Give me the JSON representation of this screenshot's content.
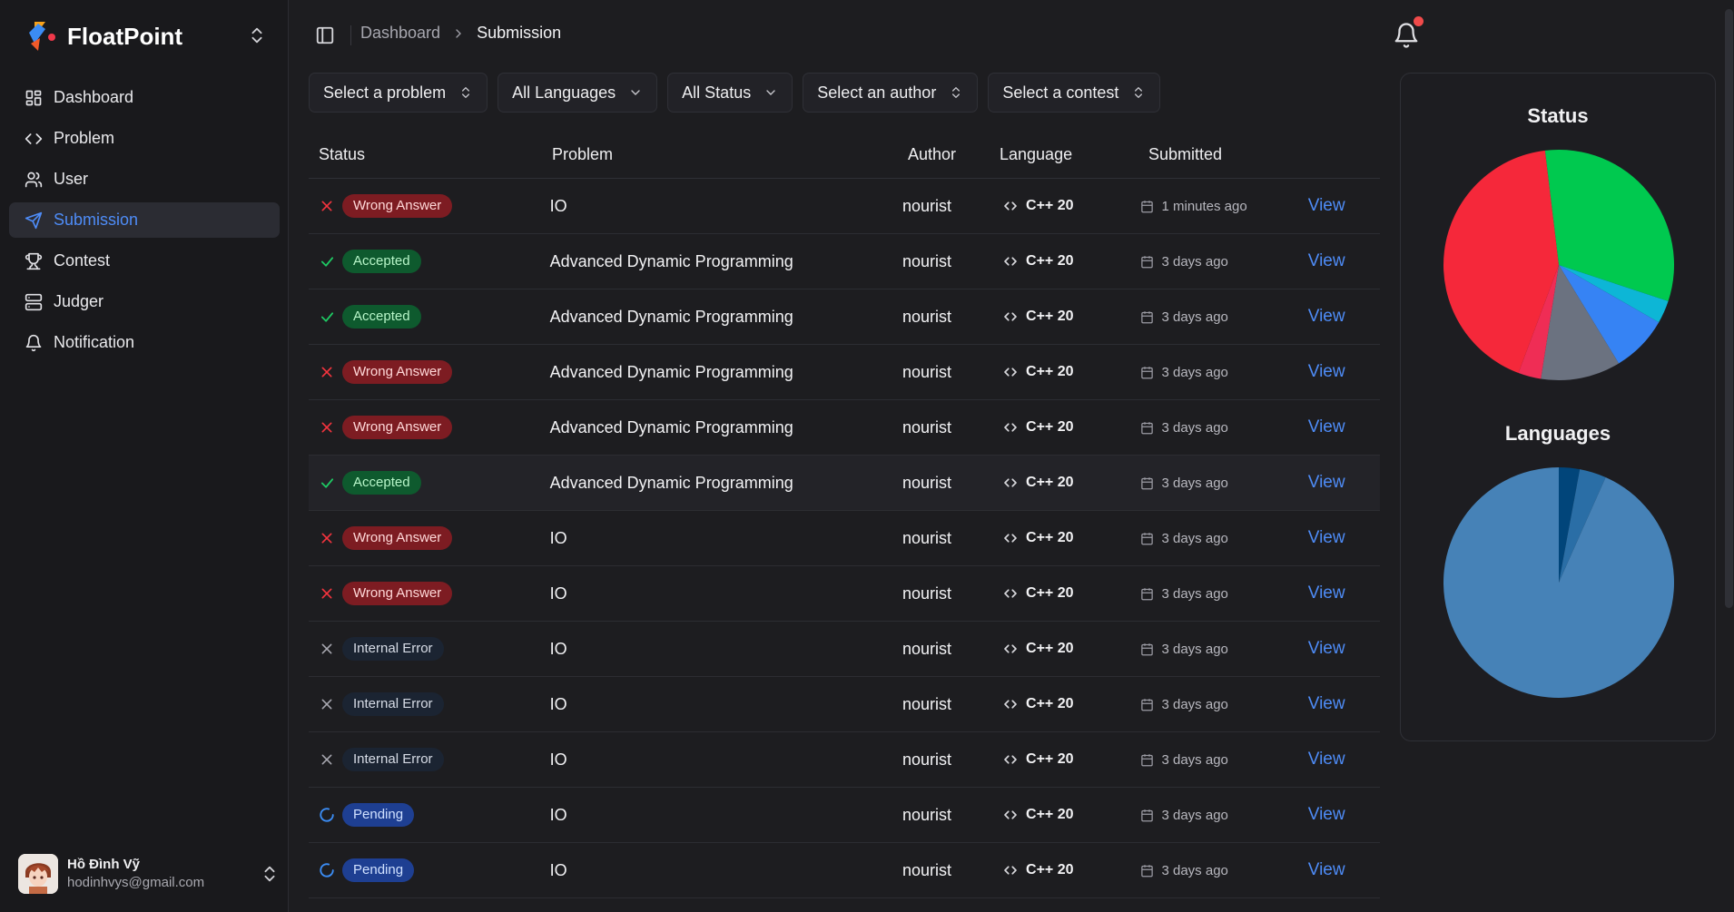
{
  "app": {
    "name": "FloatPoint"
  },
  "sidebar": {
    "items": [
      {
        "label": "Dashboard",
        "icon": "layout-grid-icon"
      },
      {
        "label": "Problem",
        "icon": "code-icon"
      },
      {
        "label": "User",
        "icon": "users-icon"
      },
      {
        "label": "Submission",
        "icon": "send-icon",
        "active": true
      },
      {
        "label": "Contest",
        "icon": "trophy-icon"
      },
      {
        "label": "Judger",
        "icon": "server-icon"
      },
      {
        "label": "Notification",
        "icon": "bell-icon"
      }
    ],
    "user": {
      "name": "Hồ Đình Vỹ",
      "email": "hodinhvys@gmail.com"
    }
  },
  "header": {
    "breadcrumb": [
      "Dashboard",
      "Submission"
    ]
  },
  "filters": [
    {
      "label": "Select a problem",
      "icon": "chevrons-up-down-icon"
    },
    {
      "label": "All Languages",
      "icon": "chevron-down-icon"
    },
    {
      "label": "All Status",
      "icon": "chevron-down-icon"
    },
    {
      "label": "Select an author",
      "icon": "chevrons-up-down-icon"
    },
    {
      "label": "Select a contest",
      "icon": "chevrons-up-down-icon"
    }
  ],
  "table": {
    "columns": [
      "Status",
      "Problem",
      "Author",
      "Language",
      "Submitted"
    ],
    "view_label": "View",
    "rows": [
      {
        "status": "Wrong Answer",
        "kind": "wa",
        "problem": "IO",
        "author": "nourist",
        "language": "C++ 20",
        "submitted": "1 minutes ago"
      },
      {
        "status": "Accepted",
        "kind": "ac",
        "problem": "Advanced Dynamic Programming",
        "author": "nourist",
        "language": "C++ 20",
        "submitted": "3 days ago"
      },
      {
        "status": "Accepted",
        "kind": "ac",
        "problem": "Advanced Dynamic Programming",
        "author": "nourist",
        "language": "C++ 20",
        "submitted": "3 days ago"
      },
      {
        "status": "Wrong Answer",
        "kind": "wa",
        "problem": "Advanced Dynamic Programming",
        "author": "nourist",
        "language": "C++ 20",
        "submitted": "3 days ago"
      },
      {
        "status": "Wrong Answer",
        "kind": "wa",
        "problem": "Advanced Dynamic Programming",
        "author": "nourist",
        "language": "C++ 20",
        "submitted": "3 days ago"
      },
      {
        "status": "Accepted",
        "kind": "ac",
        "problem": "Advanced Dynamic Programming",
        "author": "nourist",
        "language": "C++ 20",
        "submitted": "3 days ago",
        "highlighted": true
      },
      {
        "status": "Wrong Answer",
        "kind": "wa",
        "problem": "IO",
        "author": "nourist",
        "language": "C++ 20",
        "submitted": "3 days ago"
      },
      {
        "status": "Wrong Answer",
        "kind": "wa",
        "problem": "IO",
        "author": "nourist",
        "language": "C++ 20",
        "submitted": "3 days ago"
      },
      {
        "status": "Internal Error",
        "kind": "ie",
        "problem": "IO",
        "author": "nourist",
        "language": "C++ 20",
        "submitted": "3 days ago"
      },
      {
        "status": "Internal Error",
        "kind": "ie",
        "problem": "IO",
        "author": "nourist",
        "language": "C++ 20",
        "submitted": "3 days ago"
      },
      {
        "status": "Internal Error",
        "kind": "ie",
        "problem": "IO",
        "author": "nourist",
        "language": "C++ 20",
        "submitted": "3 days ago"
      },
      {
        "status": "Pending",
        "kind": "pd",
        "problem": "IO",
        "author": "nourist",
        "language": "C++ 20",
        "submitted": "3 days ago"
      },
      {
        "status": "Pending",
        "kind": "pd",
        "problem": "IO",
        "author": "nourist",
        "language": "C++ 20",
        "submitted": "3 days ago"
      }
    ]
  },
  "colors": {
    "accent": "#4e8cf7",
    "wrong": "#f5343e",
    "accepted": "#00c94f",
    "pending": "#3b8df5"
  },
  "chart_data": [
    {
      "type": "pie",
      "title": "Status",
      "slices": [
        {
          "value": 4,
          "color": "#00c94f"
        },
        {
          "value": 0.4,
          "color": "#0db6d6"
        },
        {
          "value": 1,
          "color": "#3683f4"
        },
        {
          "value": 1.4,
          "color": "#6b7280"
        },
        {
          "value": 0.4,
          "color": "#ef2d55"
        },
        {
          "value": 5.3,
          "color": "#f5283a"
        }
      ]
    },
    {
      "type": "pie",
      "title": "Languages",
      "slices": [
        {
          "value": 0.35,
          "color": "#01457a"
        },
        {
          "value": 0.45,
          "color": "#2a6ea6"
        },
        {
          "value": 11.2,
          "color": "#4682b7"
        }
      ]
    }
  ]
}
